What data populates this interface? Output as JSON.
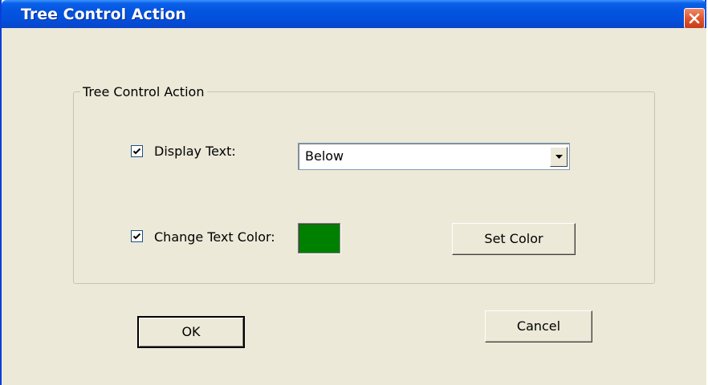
{
  "window": {
    "title": "Tree Control Action",
    "close_symbol": "×"
  },
  "group": {
    "legend": "Tree Control Action"
  },
  "display_text": {
    "checked": true,
    "label": "Display Text:",
    "selected": "Below"
  },
  "change_color": {
    "checked": true,
    "label": "Change Text Color:",
    "swatch_color": "#008000"
  },
  "buttons": {
    "set_color": "Set Color",
    "ok": "OK",
    "cancel": "Cancel"
  },
  "icons": {
    "close": "close-icon",
    "check": "checkmark-icon",
    "dropdown": "chevron-down-icon"
  }
}
